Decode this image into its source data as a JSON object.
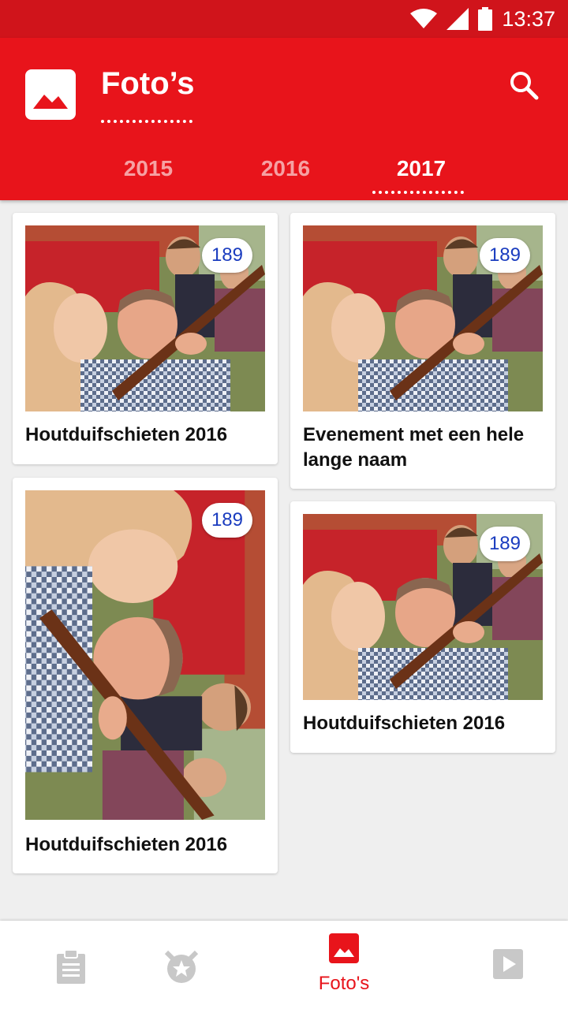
{
  "status_bar": {
    "time": "13:37"
  },
  "header": {
    "title": "Foto’s",
    "logo_icon": "photo-album-icon",
    "search_icon": "search-icon"
  },
  "tabs": [
    {
      "label": "2015",
      "active": false
    },
    {
      "label": "2016",
      "active": false
    },
    {
      "label": "2017",
      "active": true
    }
  ],
  "albums": [
    {
      "title": "Houtduifschieten 2016",
      "count": "189",
      "orientation": "landscape"
    },
    {
      "title": "Evenement met een hele lange naam",
      "count": "189",
      "orientation": "landscape"
    },
    {
      "title": "Houtduifschieten 2016",
      "count": "189",
      "orientation": "portrait"
    },
    {
      "title": "Houtduifschieten 2016",
      "count": "189",
      "orientation": "landscape"
    }
  ],
  "bottom_nav": [
    {
      "icon": "clipboard-icon",
      "label": "",
      "active": false
    },
    {
      "icon": "badge-star-icon",
      "label": "",
      "active": false
    },
    {
      "icon": "photo-icon",
      "label": "Foto's",
      "active": true
    },
    {
      "icon": "play-icon",
      "label": "",
      "active": false
    }
  ],
  "colors": {
    "brand_red": "#e8141b",
    "status_red": "#d0141b",
    "badge_text": "#1a3cbf",
    "inactive_icon": "#c8c8c8"
  }
}
